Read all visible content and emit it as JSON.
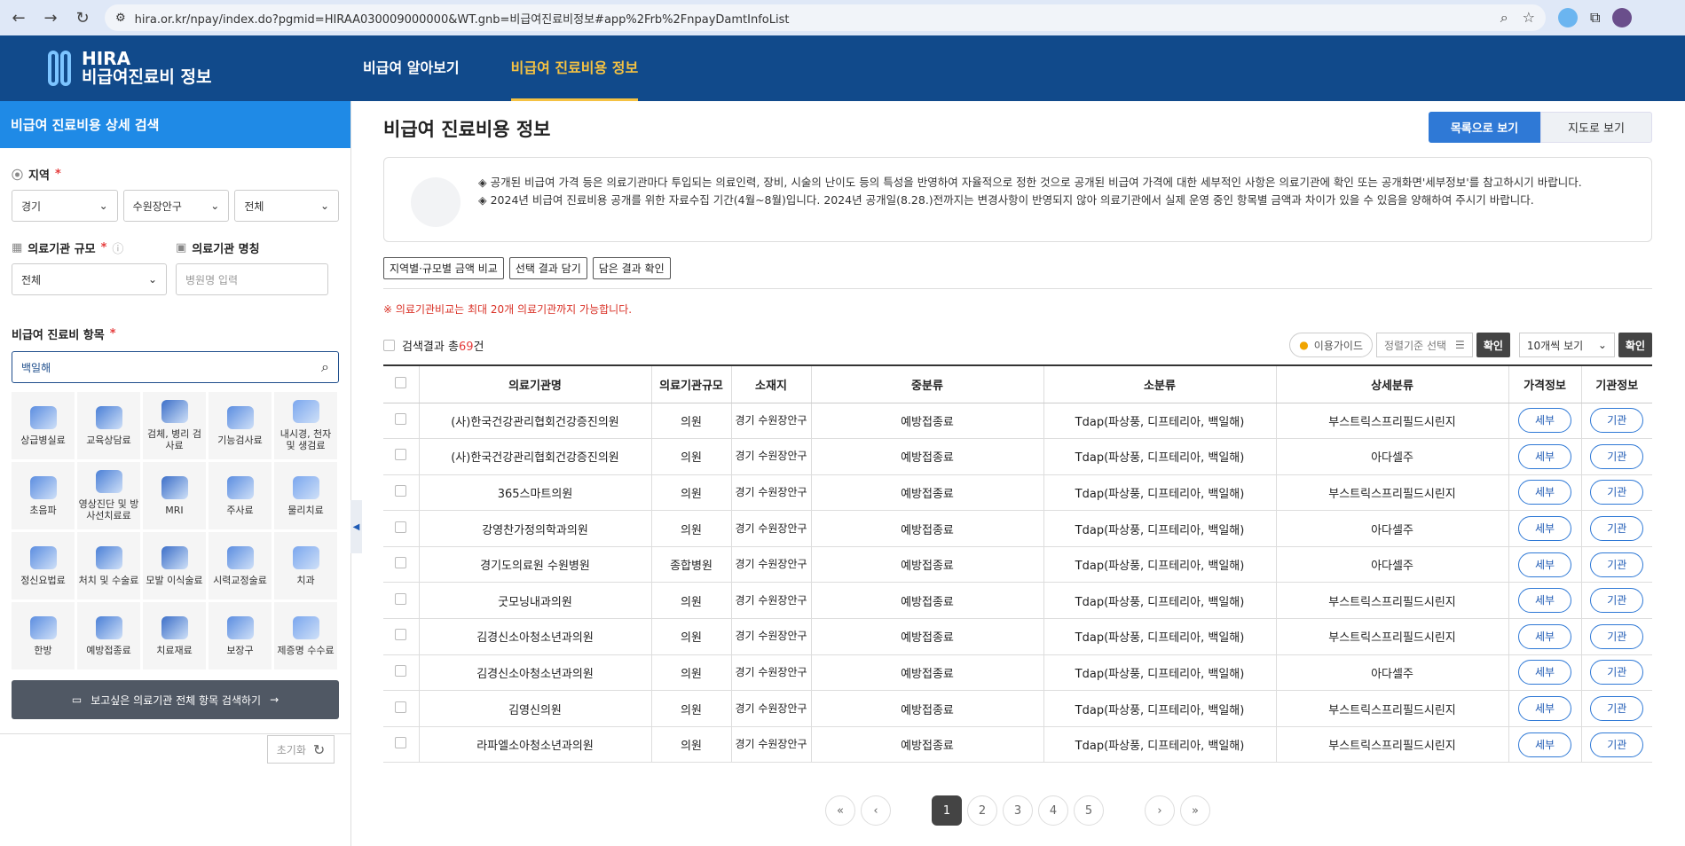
{
  "browser": {
    "url": "hira.or.kr/npay/index.do?pgmid=HIRAA030009000000&WT.gnb=비급여진료비정보#app%2Frb%2FnpayDamtInfoList"
  },
  "header": {
    "logo_top": "HIRA",
    "logo_bottom": "비급여진료비 정보",
    "nav": [
      "비급여 알아보기",
      "비급여 진료비용 정보"
    ]
  },
  "sidebar": {
    "title": "비급여 진료비용 상세 검색",
    "region_label": "지역",
    "region": [
      "경기",
      "수원장안구",
      "전체"
    ],
    "scale_label": "의료기관 규모",
    "scale_value": "전체",
    "name_label": "의료기관 명칭",
    "name_placeholder": "병원명 입력",
    "item_label": "비급여 진료비 항목",
    "search_value": "백일해",
    "categories": [
      "상급병실료",
      "교육상담료",
      "검체, 병리 검사료",
      "기능검사료",
      "내시경, 천자 및 생검료",
      "초음파",
      "영상진단 및 방사선치료료",
      "MRI",
      "주사료",
      "물리치료",
      "정신요법료",
      "처치 및 수술료",
      "모발 이식술료",
      "시력교정술료",
      "치과",
      "한방",
      "예방접종료",
      "치료재료",
      "보장구",
      "제증명 수수료"
    ],
    "cta": "보고싶은 의료기관 전체 항목 검색하기",
    "reset": "초기화"
  },
  "main": {
    "title": "비급여 진료비용 정보",
    "view_list": "목록으로 보기",
    "view_map": "지도로 보기",
    "notice1": "◈ 공개된 비급여 가격 등은 의료기관마다 투입되는 의료인력, 장비, 시술의 난이도 등의 특성을 반영하여 자율적으로 정한 것으로 공개된 비급여 가격에 대한 세부적인 사항은 의료기관에 확인 또는 공개화면'세부정보'를 참고하시기 바랍니다.",
    "notice2": "◈ 2024년 비급여 진료비용 공개를 위한 자료수집 기간(4월~8월)입니다. 2024년 공개일(8.28.)전까지는 변경사항이 반영되지 않아 의료기관에서 실제 운영 중인 항목별 금액과 차이가 있을 수 있음을 양해하여 주시기 바랍니다.",
    "tools": [
      "지역별·규모별 금액 비교",
      "선택 결과 담기",
      "담은 결과 확인"
    ],
    "warning": "※ 의료기관비교는 최대 20개 의료기관까지 가능합니다.",
    "result_prefix": "검색결과 총",
    "result_count": "69",
    "result_suffix": "건",
    "guide": "이용가이드",
    "sort_label": "정렬기준 선택",
    "confirm": "확인",
    "per_page": "10개씩 보기",
    "columns": [
      "의료기관명",
      "의료기관규모",
      "소재지",
      "중분류",
      "소분류",
      "상세분류",
      "가격정보",
      "기관정보"
    ],
    "rows": [
      [
        "(사)한국건강관리협회건강증진의원",
        "의원",
        "경기 수원장안구",
        "예방접종료",
        "Tdap(파상풍, 디프테리아, 백일해)",
        "부스트릭스프리필드시린지"
      ],
      [
        "(사)한국건강관리협회건강증진의원",
        "의원",
        "경기 수원장안구",
        "예방접종료",
        "Tdap(파상풍, 디프테리아, 백일해)",
        "아다셀주"
      ],
      [
        "365스마트의원",
        "의원",
        "경기 수원장안구",
        "예방접종료",
        "Tdap(파상풍, 디프테리아, 백일해)",
        "부스트릭스프리필드시린지"
      ],
      [
        "강영찬가정의학과의원",
        "의원",
        "경기 수원장안구",
        "예방접종료",
        "Tdap(파상풍, 디프테리아, 백일해)",
        "아다셀주"
      ],
      [
        "경기도의료원 수원병원",
        "종합병원",
        "경기 수원장안구",
        "예방접종료",
        "Tdap(파상풍, 디프테리아, 백일해)",
        "아다셀주"
      ],
      [
        "굿모닝내과의원",
        "의원",
        "경기 수원장안구",
        "예방접종료",
        "Tdap(파상풍, 디프테리아, 백일해)",
        "부스트릭스프리필드시린지"
      ],
      [
        "김경신소아청소년과의원",
        "의원",
        "경기 수원장안구",
        "예방접종료",
        "Tdap(파상풍, 디프테리아, 백일해)",
        "부스트릭스프리필드시린지"
      ],
      [
        "김경신소아청소년과의원",
        "의원",
        "경기 수원장안구",
        "예방접종료",
        "Tdap(파상풍, 디프테리아, 백일해)",
        "아다셀주"
      ],
      [
        "김영신의원",
        "의원",
        "경기 수원장안구",
        "예방접종료",
        "Tdap(파상풍, 디프테리아, 백일해)",
        "부스트릭스프리필드시린지"
      ],
      [
        "라파엘소아청소년과의원",
        "의원",
        "경기 수원장안구",
        "예방접종료",
        "Tdap(파상풍, 디프테리아, 백일해)",
        "부스트릭스프리필드시린지"
      ]
    ],
    "detail_btn": "세부",
    "org_btn": "기관",
    "pages": [
      "1",
      "2",
      "3",
      "4",
      "5"
    ]
  }
}
